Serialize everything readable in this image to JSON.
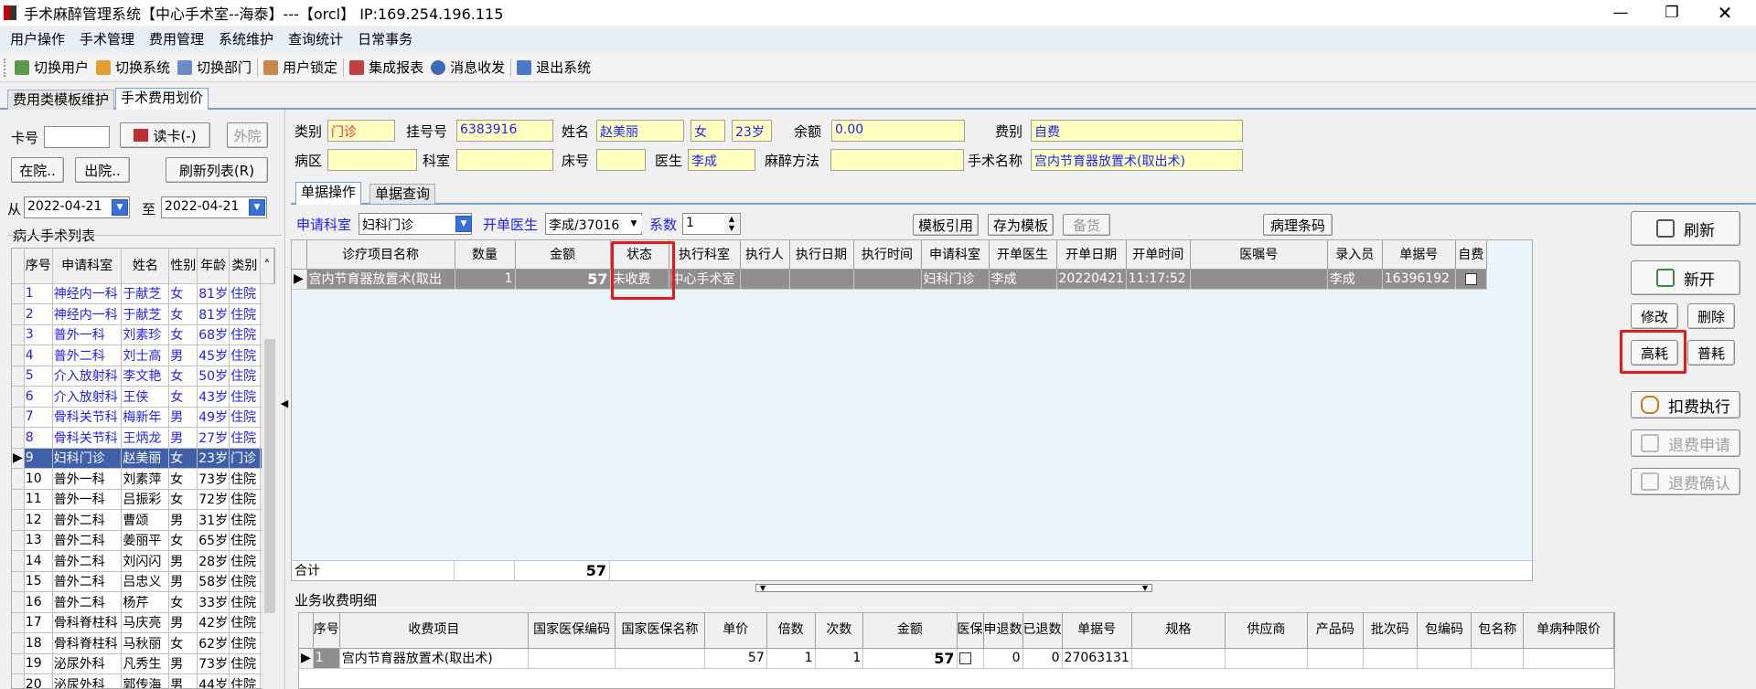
{
  "window": {
    "title": "手术麻醉管理系统【中心手术室--海泰】---【orcl】 IP:169.254.196.115"
  },
  "menu": [
    "用户操作",
    "手术管理",
    "费用管理",
    "系统维护",
    "查询统计",
    "日常事务"
  ],
  "toolbar": [
    "切换用户",
    "切换系统",
    "切换部门",
    "用户锁定",
    "集成报表",
    "消息收发",
    "退出系统"
  ],
  "tabs": [
    "费用类模板维护",
    "手术费用划价"
  ],
  "left": {
    "card_label": "卡号",
    "read_card": "读卡(-)",
    "outside": "外院",
    "in_hospital": "在院..",
    "discharged": "出院..",
    "refresh_list": "刷新列表(R)",
    "from_label": "从",
    "from_date": "2022-04-21",
    "to_label": "至",
    "to_date": "2022-04-21",
    "list_title": "病人手术列表",
    "columns": [
      "序号",
      "申请科室",
      "姓名",
      "性别",
      "年龄",
      "类别"
    ],
    "rows": [
      [
        "1",
        "神经内一科",
        "于献芝",
        "女",
        "81岁",
        "住院"
      ],
      [
        "2",
        "神经内一科",
        "于献芝",
        "女",
        "81岁",
        "住院"
      ],
      [
        "3",
        "普外一科",
        "刘素珍",
        "女",
        "68岁",
        "住院"
      ],
      [
        "4",
        "普外二科",
        "刘士高",
        "男",
        "45岁",
        "住院"
      ],
      [
        "5",
        "介入放射科",
        "李文艳",
        "女",
        "50岁",
        "住院"
      ],
      [
        "6",
        "介入放射科",
        "王侠",
        "女",
        "43岁",
        "住院"
      ],
      [
        "7",
        "骨科关节科",
        "梅新年",
        "男",
        "49岁",
        "住院"
      ],
      [
        "8",
        "骨科关节科",
        "王炳龙",
        "男",
        "27岁",
        "住院"
      ],
      [
        "9",
        "妇科门诊",
        "赵美丽",
        "女",
        "23岁",
        "门诊"
      ],
      [
        "10",
        "普外一科",
        "刘素萍",
        "女",
        "73岁",
        "住院"
      ],
      [
        "11",
        "普外一科",
        "吕振彩",
        "女",
        "72岁",
        "住院"
      ],
      [
        "12",
        "普外二科",
        "曹颂",
        "男",
        "31岁",
        "住院"
      ],
      [
        "13",
        "普外二科",
        "姜丽平",
        "女",
        "65岁",
        "住院"
      ],
      [
        "14",
        "普外二科",
        "刘闪闪",
        "男",
        "28岁",
        "住院"
      ],
      [
        "15",
        "普外二科",
        "吕忠义",
        "男",
        "58岁",
        "住院"
      ],
      [
        "16",
        "普外二科",
        "杨芹",
        "女",
        "33岁",
        "住院"
      ],
      [
        "17",
        "骨科脊柱科",
        "马庆亮",
        "男",
        "42岁",
        "住院"
      ],
      [
        "18",
        "骨科脊柱科",
        "马秋丽",
        "女",
        "62岁",
        "住院"
      ],
      [
        "19",
        "泌尿外科",
        "凡秀生",
        "男",
        "73岁",
        "住院"
      ],
      [
        "20",
        "泌尿外科",
        "郭传海",
        "男",
        "44岁",
        "住院"
      ]
    ]
  },
  "form": {
    "category_label": "类别",
    "category": "门诊",
    "reg_label": "挂号号",
    "reg_no": "6383916",
    "name_label": "姓名",
    "name": "赵美丽",
    "sex": "女",
    "age": "23岁",
    "balance_label": "余额",
    "balance": "0.00",
    "fee_label": "费别",
    "fee_type": "自费",
    "ward_label": "病区",
    "ward": "",
    "dept_label": "科室",
    "dept": "",
    "bed_label": "床号",
    "bed": "",
    "doctor_label": "医生",
    "doctor": "李成",
    "anes_label": "麻醉方法",
    "anes": "",
    "surgery_label": "手术名称",
    "surgery": "宫内节育器放置术(取出术)"
  },
  "subtabs": [
    "单据操作",
    "单据查询"
  ],
  "ops": {
    "apply_dept_label": "申请科室",
    "apply_dept": "妇科门诊",
    "doctor_label": "开单医生",
    "doctor": "李成/37016",
    "factor_label": "系数",
    "factor": "1",
    "template_use": "模板引用",
    "save_template": "存为模板",
    "stock": "备货",
    "pathology": "病理条码"
  },
  "detail": {
    "columns": [
      "诊疗项目名称",
      "数量",
      "金额",
      "状态",
      "执行科室",
      "执行人",
      "执行日期",
      "执行时间",
      "申请科室",
      "开单医生",
      "开单日期",
      "开单时间",
      "医嘱号",
      "录入员",
      "单据号",
      "自费"
    ],
    "row": [
      "宫内节育器放置术(取出",
      "1",
      "57",
      "未收费",
      "中心手术室",
      "",
      "",
      "",
      "妇科门诊",
      "李成",
      "20220421",
      "11:17:52",
      "",
      "李成",
      "16396192"
    ],
    "total_label": "合计",
    "total": "57"
  },
  "biz": {
    "title": "业务收费明细",
    "columns": [
      "序号",
      "收费项目",
      "国家医保编码",
      "国家医保名称",
      "单价",
      "倍数",
      "次数",
      "金额",
      "医保",
      "申退数",
      "已退数",
      "单据号",
      "规格",
      "供应商",
      "产品码",
      "批次码",
      "包编码",
      "包名称",
      "单病种限价"
    ],
    "row": [
      "1",
      "宫内节育器放置术(取出术)",
      "",
      "",
      "57",
      "1",
      "1",
      "57",
      "",
      "0",
      "0",
      "27063131",
      "",
      "",
      "",
      "",
      "",
      "",
      ""
    ]
  },
  "right_buttons": {
    "refresh": "刷新",
    "new": "新开",
    "modify": "修改",
    "delete": "删除",
    "high": "高耗",
    "normal": "普耗",
    "execute": "扣费执行",
    "refund_apply": "退费申请",
    "refund_confirm": "退费确认"
  }
}
